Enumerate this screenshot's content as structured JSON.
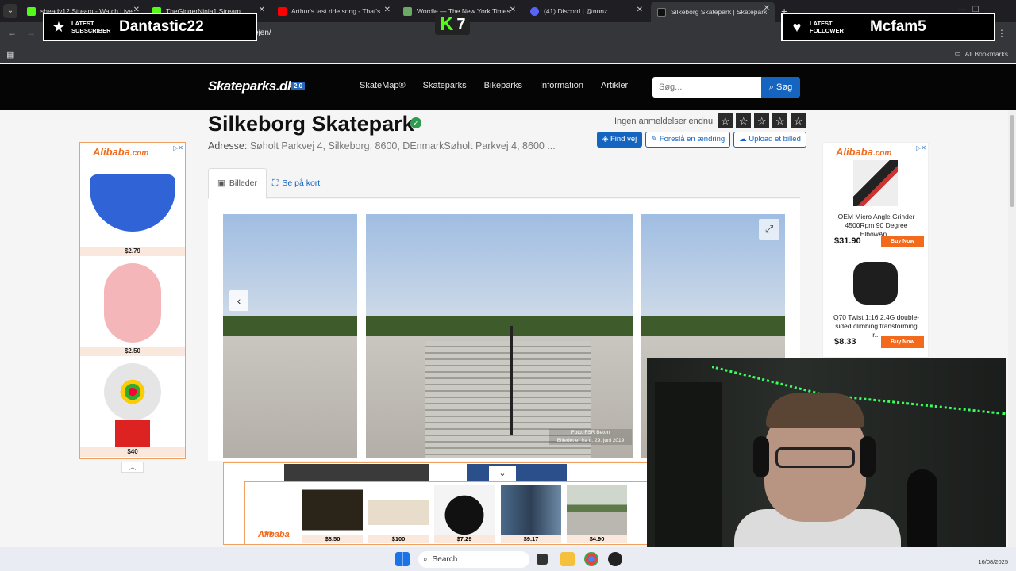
{
  "browser": {
    "tabs": [
      {
        "title": "sheady12 Stream - Watch Live",
        "favicon_color": "#53fc18"
      },
      {
        "title": "TheGingerNinja1 Stream",
        "favicon_color": "#53fc18"
      },
      {
        "title": "Arthur's last ride song - That's",
        "favicon_color": "#ff0000"
      },
      {
        "title": "Wordle — The New York Times",
        "favicon_color": "#6aaa64"
      },
      {
        "title": "(41) Discord | @nonz",
        "favicon_color": "#5865f2"
      },
      {
        "title": "Silkeborg Skatepark | Skatepark",
        "favicon_color": "#111111"
      }
    ],
    "url_fragment": "ejen/",
    "all_bookmarks": "All Bookmarks"
  },
  "overlays": {
    "subscriber": {
      "label": "LATEST SUBSCRIBER",
      "name": "Dantastic22"
    },
    "follower": {
      "label": "LATEST FOLLOWER",
      "name": "Mcfam5"
    },
    "kick_count": "7"
  },
  "site": {
    "logo": "Skateparks.dk",
    "version": "2.0",
    "nav": [
      "SkateMap®",
      "Skateparks",
      "Bikeparks",
      "Information",
      "Artikler"
    ],
    "search_placeholder": "Søg...",
    "search_button": "Søg"
  },
  "park": {
    "title": "Silkeborg Skatepark",
    "address_label": "Adresse:",
    "address_value": "Søholt Parkvej 4, Silkeborg, 8600, DEnmarkSøholt Parkvej 4, 8600 ...",
    "reviews_text": "Ingen anmeldelser endnu",
    "actions": {
      "find": "Find vej",
      "suggest": "Foreslå en ændring",
      "upload": "Upload et billed"
    },
    "tabs": {
      "images": "Billeder",
      "map": "Se på kort"
    },
    "photo_credit_1": "Foto: FSR Beton",
    "photo_credit_2": "Billedet er fra d. 29. juni 2019"
  },
  "ads": {
    "brand": "Alibaba",
    "brand_suffix": ".com",
    "left": [
      {
        "price": "$2.79"
      },
      {
        "price": "$2.50"
      },
      {
        "price": "$40"
      }
    ],
    "right": [
      {
        "title": "OEM Micro Angle Grinder 4500Rpm 90 Degree ElbowAn...",
        "price": "$31.90",
        "cta": "Buy Now"
      },
      {
        "title": "Q70 Twist 1:16 2.4G double-sided climbing transforming r...",
        "price": "$8.33",
        "cta": "Buy Now"
      }
    ],
    "bottom": [
      {
        "price": "$8.50"
      },
      {
        "price": "$100"
      },
      {
        "price": "$7.29"
      },
      {
        "price": "$9.17"
      },
      {
        "price": "$4.90"
      }
    ]
  },
  "taskbar": {
    "search": "Search",
    "date": "16/08/2025"
  }
}
